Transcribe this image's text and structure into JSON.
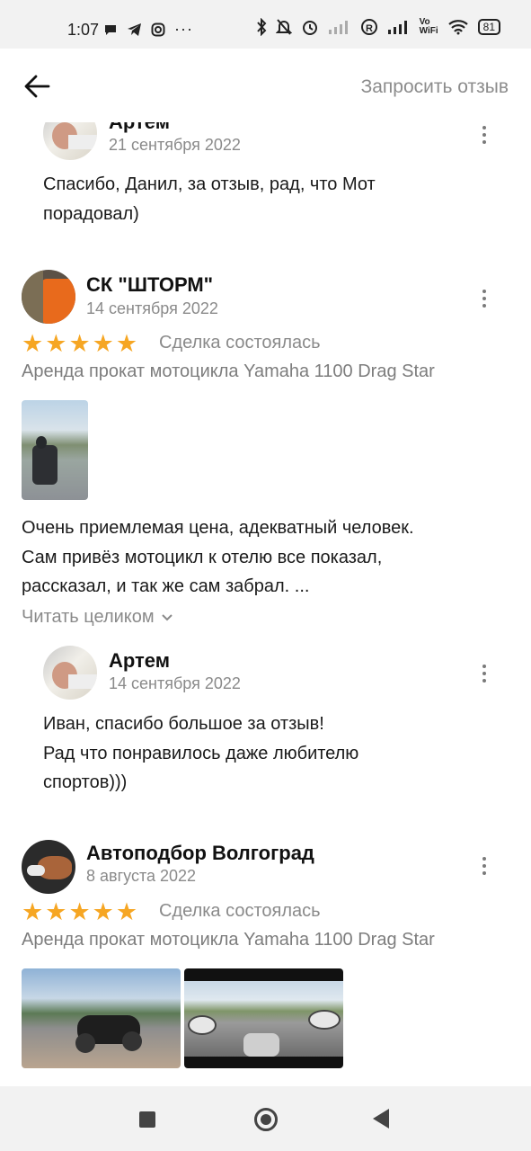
{
  "status_bar": {
    "time": "1:07",
    "battery": "81",
    "left_icons": [
      "chat-icon",
      "telegram-icon",
      "instagram-icon",
      "more-dots-icon"
    ],
    "right_icons": [
      "bluetooth-icon",
      "mute-icon",
      "alarm-icon",
      "signal-icon",
      "r-icon",
      "signal-icon",
      "vowifi-icon",
      "wifi-icon",
      "battery-icon"
    ]
  },
  "header": {
    "back_icon": "arrow-left-icon",
    "request_review": "Запросить отзыв"
  },
  "reviews": [
    {
      "reply_top": {
        "author": "Артем",
        "date": "21 сентября 2022",
        "lines": [
          "Спасибо, Данил, за отзыв, рад, что Мот",
          "порадовал)"
        ]
      }
    },
    {
      "author": "СК \"ШТОРМ\"",
      "date": "14 сентября 2022",
      "rating": 5,
      "status": "Сделка состоялась",
      "service": "Аренда прокат мотоцикла Yamaha 1100 Drag Star",
      "text_lines": [
        "Очень приемлемая цена, адекватный человек.",
        "Сам привёз мотоцикл к отелю все показал,",
        "рассказал, и так же сам забрал. ..."
      ],
      "read_more": "Читать целиком",
      "reply": {
        "author": "Артем",
        "date": "14 сентября 2022",
        "lines": [
          "Иван, спасибо большое за отзыв!",
          "Рад что понравилось даже любителю",
          "спортов)))"
        ]
      }
    },
    {
      "author": "Автоподбор Волгоград",
      "date": "8 августа 2022",
      "rating": 5,
      "status": "Сделка состоялась",
      "service": "Аренда прокат мотоцикла Yamaha 1100 Drag Star"
    }
  ],
  "star_char": "★",
  "colors": {
    "star": "#f6a623",
    "muted": "#8a8a8a"
  }
}
